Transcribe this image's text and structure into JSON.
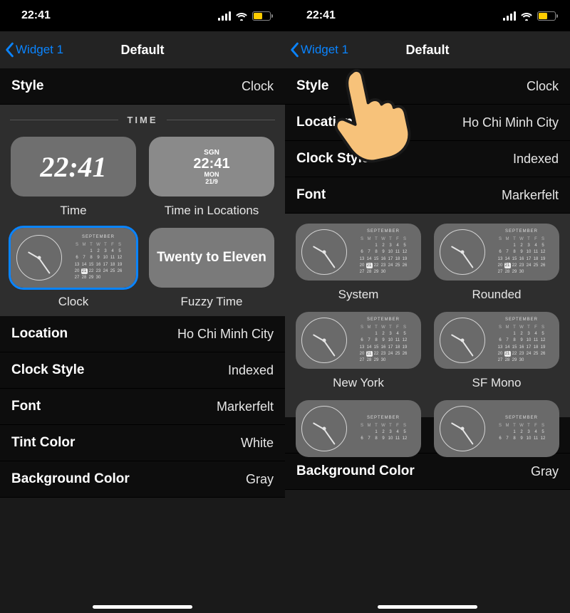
{
  "status": {
    "time": "22:41"
  },
  "nav": {
    "back": "Widget 1",
    "title": "Default"
  },
  "rows": {
    "style": {
      "k": "Style",
      "v": "Clock"
    },
    "location": {
      "k": "Location",
      "v": "Ho Chi Minh City"
    },
    "clock_style": {
      "k": "Clock Style",
      "v": "Indexed"
    },
    "font": {
      "k": "Font",
      "v": "Markerfelt"
    },
    "tint_color": {
      "k": "Tint Color",
      "v": "White"
    },
    "background_color": {
      "k": "Background Color",
      "v": "Gray"
    }
  },
  "time_section": {
    "header": "TIME",
    "tiles": {
      "time": {
        "label": "Time",
        "big": "22:41"
      },
      "time_loc": {
        "label": "Time in Locations",
        "code": "SGN",
        "time": "22:41",
        "day": "MON",
        "date": "21/9"
      },
      "clock": {
        "label": "Clock",
        "month": "SEPTEMBER"
      },
      "fuzzy": {
        "label": "Fuzzy Time",
        "text": "Twenty to Eleven"
      }
    }
  },
  "font_section": {
    "month": "SEPTEMBER",
    "options": {
      "system": "System",
      "rounded": "Rounded",
      "newyork": "New York",
      "sfmono": "SF Mono"
    }
  },
  "right_partial_rows": {
    "location_k": "Location",
    "clockstyle_k": "Clock Style"
  }
}
